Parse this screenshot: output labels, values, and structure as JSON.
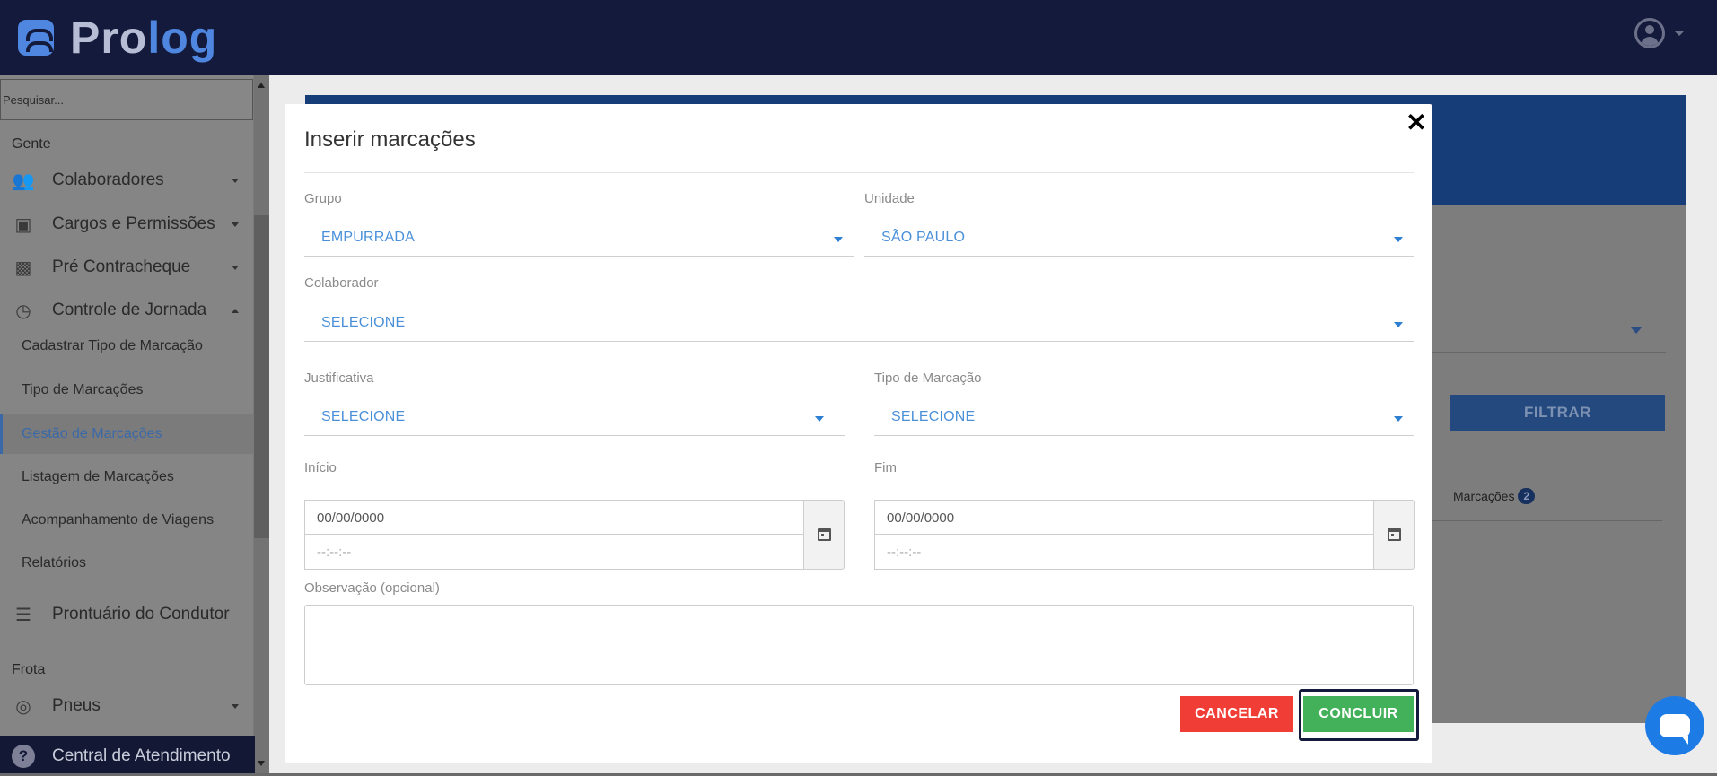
{
  "app": {
    "logo_part1": "Pro",
    "logo_part2": "log"
  },
  "sidebar": {
    "search_placeholder": "Pesquisar...",
    "section_gente": "Gente",
    "items": [
      {
        "label": "Colaboradores",
        "icon": "people-icon"
      },
      {
        "label": "Cargos e Permissões",
        "icon": "badge-icon"
      },
      {
        "label": "Pré Contracheque",
        "icon": "wallet-icon"
      },
      {
        "label": "Controle de Jornada",
        "icon": "clock-check-icon"
      }
    ],
    "subitems": [
      {
        "label": "Cadastrar Tipo de Marcação"
      },
      {
        "label": "Tipo de Marcações"
      },
      {
        "label": "Gestão de Marcações",
        "active": true
      },
      {
        "label": "Listagem de Marcações"
      },
      {
        "label": "Acompanhamento de Viagens"
      },
      {
        "label": "Relatórios"
      }
    ],
    "prontuario": "Prontuário do Condutor",
    "section_frota": "Frota",
    "pneus": "Pneus",
    "help": "Central de Atendimento"
  },
  "background": {
    "filter_button": "FILTRAR",
    "tab_label": "Marcações",
    "tab_badge": "2"
  },
  "modal": {
    "title": "Inserir marcações",
    "close": "✕",
    "grupo_label": "Grupo",
    "grupo_value": "EMPURRADA",
    "unidade_label": "Unidade",
    "unidade_value": "SÃO PAULO",
    "colaborador_label": "Colaborador",
    "colaborador_value": "SELECIONE",
    "justificativa_label": "Justificativa",
    "justificativa_value": "SELECIONE",
    "tipo_label": "Tipo de Marcação",
    "tipo_value": "SELECIONE",
    "inicio_label": "Início",
    "inicio_date_placeholder": "00/00/0000",
    "inicio_time_placeholder": "--:--:--",
    "fim_label": "Fim",
    "fim_date_placeholder": "00/00/0000",
    "fim_time_placeholder": "--:--:--",
    "observacao_label": "Observação (opcional)",
    "cancel_button": "CANCELAR",
    "confirm_button": "CONCLUIR"
  },
  "colors": {
    "topbar": "#141a3b",
    "accent_blue": "#4a90d9",
    "cancel_red": "#f03e36",
    "confirm_green": "#43b05a"
  }
}
